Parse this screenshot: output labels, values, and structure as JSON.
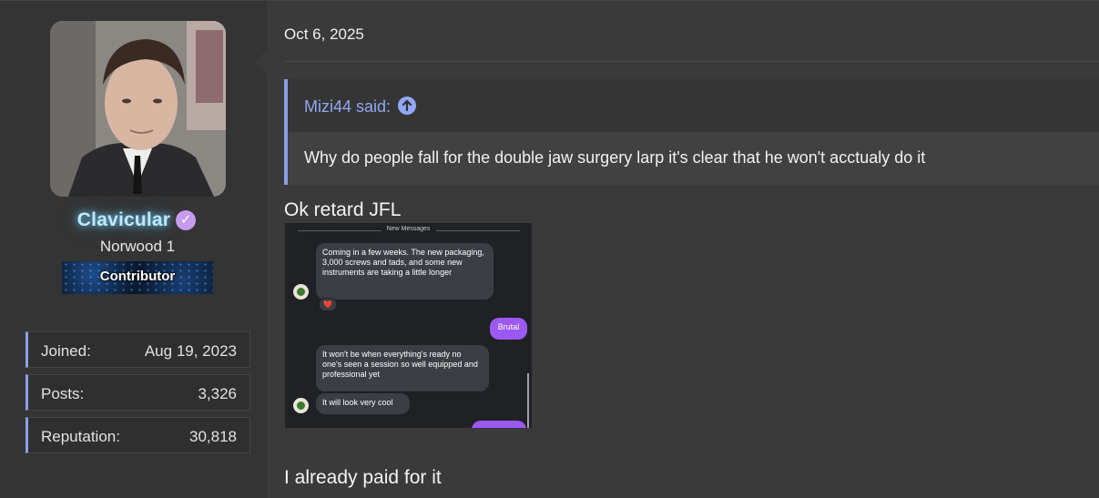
{
  "post": {
    "date": "Oct 6, 2025",
    "quote": {
      "author_label": "Mizi44 said:",
      "text": "Why do people fall for the double jaw surgery larp it's clear that he won't acctualy do it"
    },
    "reply_line_1": "Ok retard JFL",
    "reply_line_2": "I already paid for it"
  },
  "user": {
    "username": "Clavicular",
    "title": "Norwood 1",
    "banner": "Contributor",
    "stats": [
      {
        "label": "Joined:",
        "value": "Aug 19, 2023"
      },
      {
        "label": "Posts:",
        "value": "3,326"
      },
      {
        "label": "Reputation:",
        "value": "30,818"
      }
    ]
  },
  "chat": {
    "divider_label": "New Messages",
    "messages": [
      {
        "from": "them",
        "text": "Coming in a few weeks. The new packaging, 3,000 screws and tads, and some new instruments are taking a little longer"
      },
      {
        "from": "me",
        "text": "Brutal"
      },
      {
        "from": "them",
        "text": "It won't be when everything's ready no one's seen a session so well equipped and professional yet"
      },
      {
        "from": "them",
        "text": "It will look very cool"
      }
    ],
    "reaction": "❤️"
  },
  "icons": {
    "verified": "verified-check-icon",
    "quote_jump": "arrow-up-circle-icon"
  },
  "colors": {
    "accent": "#8c9ee8",
    "quote_author": "#92a8f2",
    "username_glow": "#78dcff",
    "verified_badge": "#c79bef",
    "sent_bubble": "#9b59f0"
  }
}
